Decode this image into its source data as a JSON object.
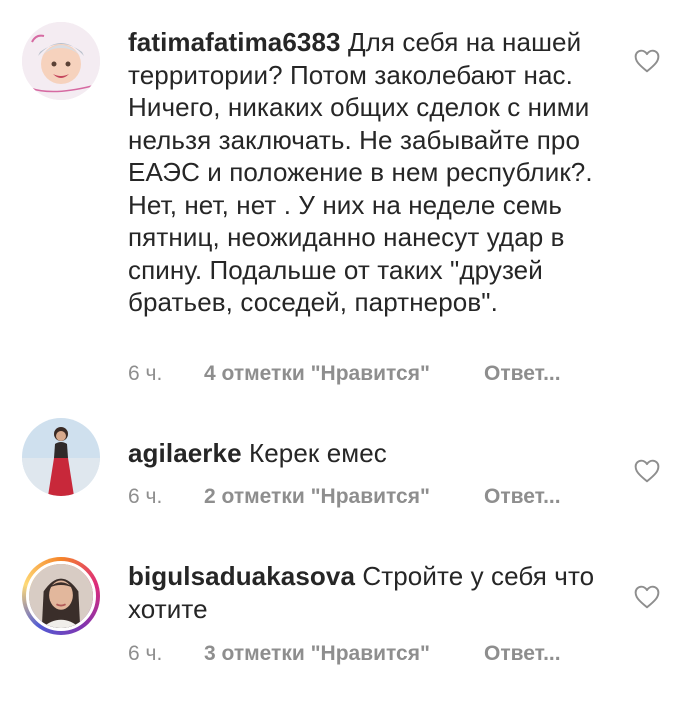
{
  "comments": [
    {
      "username": "fatimafatima6383",
      "text": "Для себя на нашей территории? Потом заколебают нас. Ничего, никаких общих сделок с ними нельзя  заключать. Не забывайте про ЕАЭС  и положение в нем республик?. Нет, нет, нет . У них на неделе семь пятниц, неожиданно нанесут удар в спину. Подальше от таких \"друзей  братьев, соседей, партнеров\".",
      "time": "6 ч.",
      "likes": "4 отметки \"Нравится\"",
      "reply": "Ответ..."
    },
    {
      "username": "agilaerke",
      "text": "Керек емес",
      "time": "6 ч.",
      "likes": "2 отметки \"Нравится\"",
      "reply": "Ответ..."
    },
    {
      "username": "bigulsaduakasova",
      "text": "Стройте у себя что хотите",
      "time": "6 ч.",
      "likes": "3 отметки \"Нравится\"",
      "reply": "Ответ..."
    }
  ],
  "icons": {
    "like": "heart-outline-icon"
  }
}
